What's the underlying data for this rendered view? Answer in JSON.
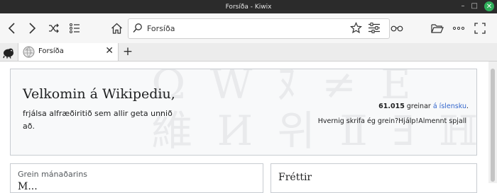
{
  "window": {
    "title": "Forsíða - Kiwix"
  },
  "toolbar": {
    "icons": [
      "chevron-left-icon",
      "chevron-right-icon",
      "shuffle-icon",
      "list-icon",
      "home-icon",
      "search-icon",
      "star-icon",
      "sliders-icon",
      "reading-glasses-icon",
      "folder-icon",
      "more-icon",
      "fullscreen-icon"
    ],
    "address_value": "Forsíða"
  },
  "tabs": [
    {
      "label": "Forsíða"
    }
  ],
  "content": {
    "welcome_title": "Velkomin á Wikipediu,",
    "welcome_subtitle": "frjálsa alfræðiritið sem allir geta unnið að.",
    "stats_count": "61.015",
    "stats_text": "greinar",
    "stats_link": "á íslensku",
    "help_links": "Hvernig skrifa ég grein?Hjálp!Almennt spjall",
    "month_label": "Grein mánaðarins",
    "month_title": "M...",
    "news_title": "Fréttir"
  },
  "colors": {
    "link": "#3366cc",
    "titlebar": "#2b2b2b",
    "close": "#2fae5a"
  }
}
